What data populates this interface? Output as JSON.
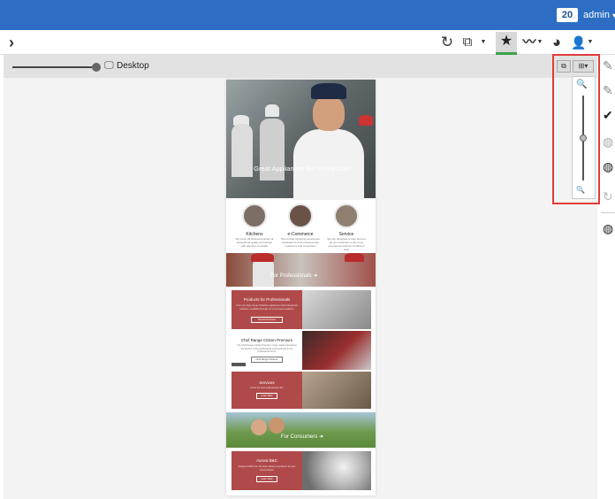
{
  "topbar": {
    "count_badge": "20",
    "user_label": "admin",
    "user_caret": "▾"
  },
  "toolbar": {
    "expand_icon": "chevron-right-icon",
    "items": [
      {
        "name": "refresh",
        "glyph": "↻"
      },
      {
        "name": "external-link",
        "glyph": "⧉"
      },
      {
        "name": "star",
        "glyph": "★"
      },
      {
        "name": "chart",
        "glyph": "〰"
      },
      {
        "name": "pie",
        "glyph": "◕"
      },
      {
        "name": "user",
        "glyph": "👤"
      }
    ]
  },
  "preview_bar": {
    "device_icon": "desktop-icon",
    "device_label": "Desktop"
  },
  "page_preview": {
    "hero_title": "Great Appliances For Every Chef",
    "features": [
      {
        "title": "Kitchens",
        "text": "We cover all business kitchen at exceptional quality and design with attention to details"
      },
      {
        "title": "e-Commerce",
        "text": "We provide shopping experience dedicated to food professionals customers and consumers"
      },
      {
        "title": "Service",
        "text": "We are designed to help and set up your business to the most experiences kitchen to efficient work"
      }
    ],
    "professionals_band": "For Professionals ➜",
    "products_box": {
      "title": "Products for Professionals",
      "text": "From our large range of kitchen appliances and professional solutions, available through our e-commerce platform",
      "button": "Browse Products"
    },
    "chef_box": {
      "title": "Chef Range Citizen Premium",
      "text": "The Chef Range Citizen Premium range makes the kitchen the kitchen of the professional chef becomes in the professional home",
      "button": "Chef Range Products"
    },
    "services_box": {
      "title": "Services",
      "text": "Know the best professional care",
      "button": "Learn More"
    },
    "consumers_band": "For Consumers ➜",
    "aurora_box": {
      "title": "Aurora B&C",
      "text": "Designed with love, the best culinary experience for your home kitchen",
      "button": "Learn More"
    }
  },
  "zoom_panel": {
    "zoom_in_icon": "magnifier-plus-icon",
    "zoom_out_icon": "magnifier-minus-icon",
    "level": 0.5
  },
  "colors": {
    "topbar": "#2d6ec4",
    "highlight": "#e23b3b",
    "active_tab": "#3aa349",
    "red_box": "#b04a4a"
  }
}
